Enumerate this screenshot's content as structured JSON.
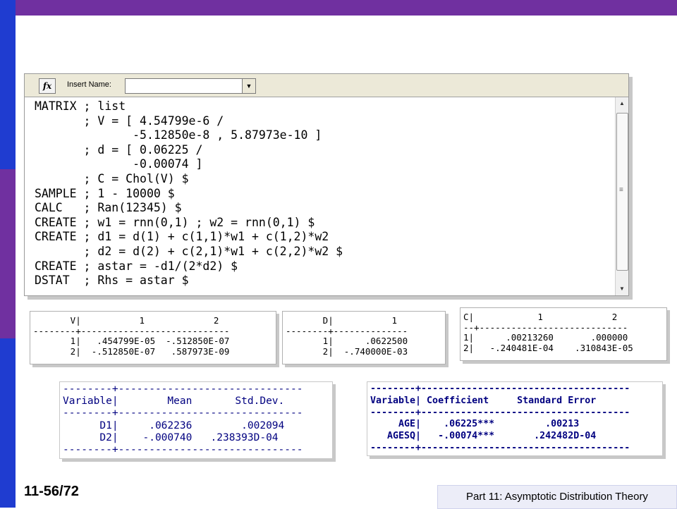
{
  "toolbar": {
    "fx_label": "fx",
    "insert_name_label": "Insert Name:",
    "insert_name_value": ""
  },
  "command_window": {
    "lines": [
      "MATRIX ; list",
      "       ; V = [ 4.54799e-6 /",
      "              -5.12850e-8 , 5.87973e-10 ]",
      "       ; d = [ 0.06225 /",
      "              -0.00074 ]",
      "       ; C = Chol(V) $",
      "SAMPLE ; 1 - 10000 $",
      "CALC   ; Ran(12345) $",
      "CREATE ; w1 = rnn(0,1) ; w2 = rnn(0,1) $",
      "CREATE ; d1 = d(1) + c(1,1)*w1 + c(1,2)*w2",
      "       ; d2 = d(2) + c(2,1)*w1 + c(2,2)*w2 $",
      "CREATE ; astar = -d1/(2*d2) $",
      "DSTAT  ; Rhs = astar $"
    ]
  },
  "matrix_v": {
    "lines": [
      "       V|           1             2",
      "--------+----------------------------",
      "       1|   .454799E-05  -.512850E-07",
      "       2|  -.512850E-07   .587973E-09"
    ]
  },
  "matrix_d": {
    "lines": [
      "       D|           1",
      "--------+--------------",
      "       1|      .0622500",
      "       2|  -.740000E-03"
    ]
  },
  "matrix_c": {
    "lines": [
      "C|            1             2",
      "--+----------------------------",
      "1|      .00213260       .000000",
      "2|   -.240481E-04    .310843E-05"
    ]
  },
  "dstat_table": {
    "lines": [
      "--------+------------------------------",
      "Variable|        Mean       Std.Dev.",
      "--------+------------------------------",
      "      D1|     .062236        .002094",
      "      D2|    -.000740   .238393D-04",
      "--------+------------------------------"
    ]
  },
  "coef_table": {
    "lines": [
      "--------+-------------------------------------",
      "Variable| Coefficient     Standard Error",
      "--------+-------------------------------------",
      "     AGE|    .06225***         .00213",
      "   AGESQ|   -.00074***       .242482D-04",
      "--------+-------------------------------------"
    ]
  },
  "footer": {
    "slide_number": "11-56/72",
    "part_title": "Part 11: Asymptotic Distribution Theory"
  },
  "colors": {
    "top_bar": "#7030a0",
    "side_bar": "#1f3cd0",
    "table_text": "#000080"
  }
}
